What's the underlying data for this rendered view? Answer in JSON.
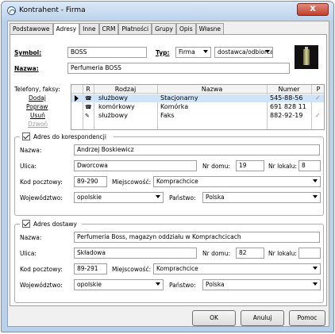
{
  "window": {
    "title": "Kontrahent - Firma",
    "close": "X"
  },
  "tabs": [
    "Podstawowe",
    "Adresy",
    "Inne",
    "CRM",
    "Płatności",
    "Grupy",
    "Opis",
    "Własne"
  ],
  "header": {
    "symbol_label": "Symbol:",
    "symbol_value": "BOSS",
    "typ_label": "Typ:",
    "typ_value": "Firma",
    "role_value": "dostawca/odbiorca",
    "nazwa_label": "Nazwa:",
    "nazwa_value": "Perfumeria BOSS"
  },
  "phones": {
    "label": "Telefony, faksy:",
    "actions": [
      "Dodaj",
      "Popraw",
      "Usuń",
      "Dzwoń"
    ],
    "columns": [
      "R",
      "Rodzaj",
      "Nazwa",
      "Numer",
      "P"
    ],
    "rows": [
      {
        "rodzaj": "służbowy",
        "nazwa": "Stacjonarny",
        "numer": "545-88-56",
        "p": "✓"
      },
      {
        "rodzaj": "komórkowy",
        "nazwa": "Komórka",
        "numer": "691 828 11",
        "p": ""
      },
      {
        "rodzaj": "służbowy",
        "nazwa": "Faks",
        "numer": "882-92-19",
        "p": "✓"
      }
    ]
  },
  "correspondence": {
    "title": "Adres do korespondencji",
    "nazwa_label": "Nazwa:",
    "nazwa": "Andrzej Boskiewicz",
    "ulica_label": "Ulica:",
    "ulica": "Dworcowa",
    "nr_domu_label": "Nr domu:",
    "nr_domu": "19",
    "nr_lokalu_label": "Nr lokalu:",
    "nr_lokalu": "8",
    "kod_label": "Kod pocztowy:",
    "kod": "89-290",
    "miejscowosc_label": "Miejscowość:",
    "miejscowosc": "Komprachcice",
    "woj_label": "Województwo:",
    "woj": "opolskie",
    "panstwo_label": "Państwo:",
    "panstwo": "Polska"
  },
  "delivery": {
    "title": "Adres dostawy",
    "nazwa_label": "Nazwa:",
    "nazwa": "Perfumeria Boss, magazyn oddziału w Komprachcicach",
    "ulica_label": "Ulica:",
    "ulica": "Składowa",
    "nr_domu_label": "Nr domu:",
    "nr_domu": "82",
    "nr_lokalu_label": "Nr lokalu:",
    "nr_lokalu": "",
    "kod_label": "Kod pocztowy:",
    "kod": "89-291",
    "miejscowosc_label": "Miejscowość:",
    "miejscowosc": "Komprachcice",
    "woj_label": "Województwo:",
    "woj": "opolskie",
    "panstwo_label": "Państwo:",
    "panstwo": "Polska"
  },
  "buttons": {
    "ok": "OK",
    "cancel": "Anuluj",
    "help": "Pomoc"
  }
}
